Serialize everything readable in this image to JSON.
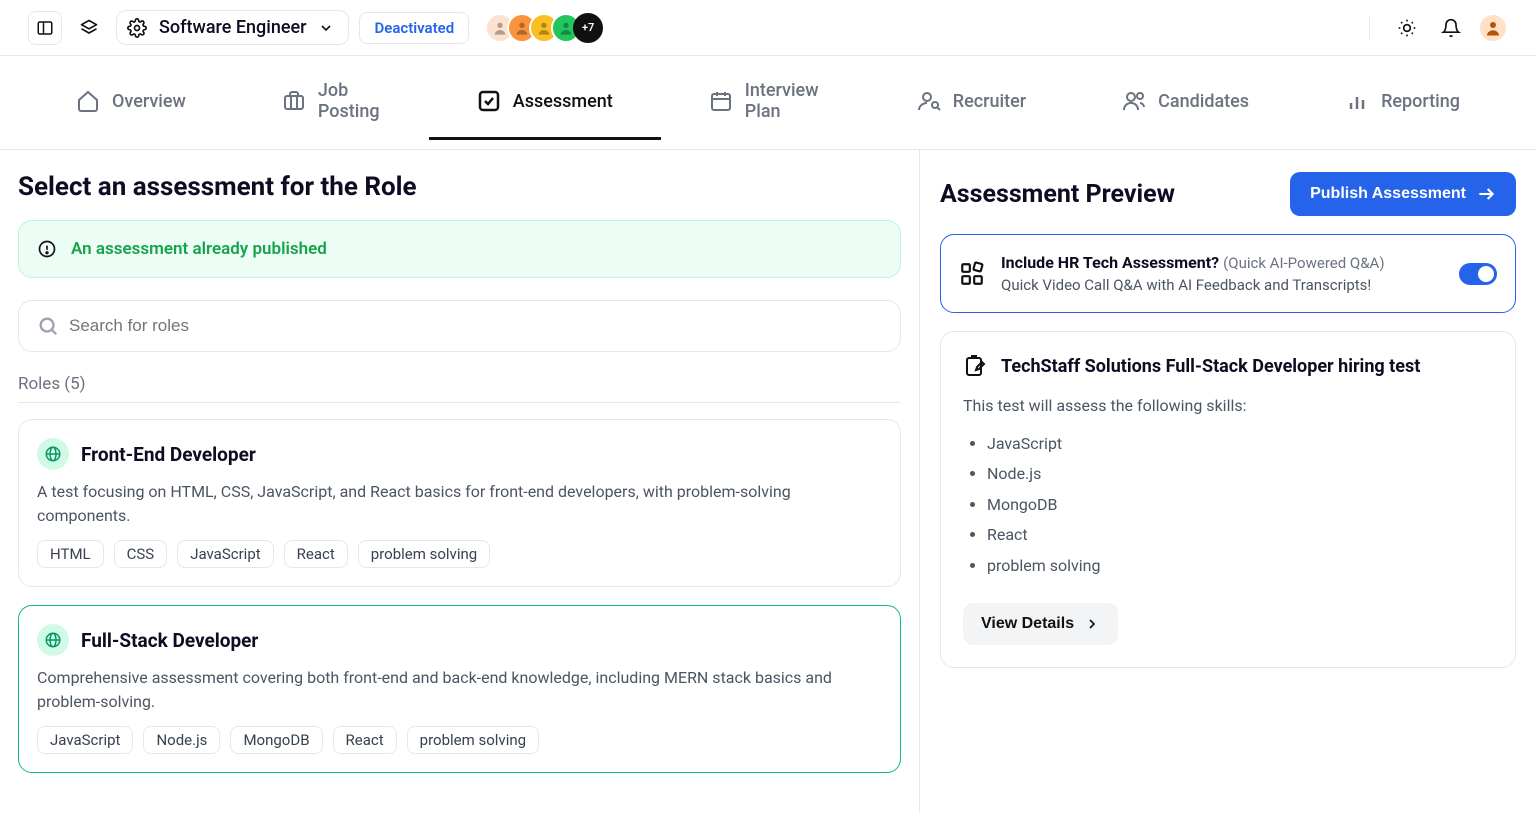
{
  "header": {
    "role_name": "Software Engineer",
    "status_chip": "Deactivated",
    "avatar_more": "+7",
    "avatar_colors": [
      "#fde2cf",
      "#fb923c",
      "#fbbf24",
      "#22c55e"
    ]
  },
  "tabs": [
    {
      "id": "overview",
      "label": "Overview"
    },
    {
      "id": "job-posting",
      "label": "Job Posting"
    },
    {
      "id": "assessment",
      "label": "Assessment",
      "active": true
    },
    {
      "id": "interview-plan",
      "label": "Interview Plan"
    },
    {
      "id": "recruiter",
      "label": "Recruiter"
    },
    {
      "id": "candidates",
      "label": "Candidates"
    },
    {
      "id": "reporting",
      "label": "Reporting"
    }
  ],
  "left": {
    "title": "Select an assessment for the Role",
    "alert": "An assessment already published",
    "search_placeholder": "Search for roles",
    "roles_label": "Roles (5)",
    "roles": [
      {
        "title": "Front-End Developer",
        "desc": "A test focusing on HTML, CSS, JavaScript, and React basics for front-end developers, with problem-solving components.",
        "tags": [
          "HTML",
          "CSS",
          "JavaScript",
          "React",
          "problem solving"
        ],
        "selected": false
      },
      {
        "title": "Full-Stack Developer",
        "desc": "Comprehensive assessment covering both front-end and back-end knowledge, including MERN stack basics and problem-solving.",
        "tags": [
          "JavaScript",
          "Node.js",
          "MongoDB",
          "React",
          "problem solving"
        ],
        "selected": true
      }
    ]
  },
  "right": {
    "preview_title": "Assessment Preview",
    "publish_label": "Publish Assessment",
    "hr_box": {
      "title": "Include HR Tech Assessment?",
      "hint": "(Quick AI-Powered Q&A)",
      "subtitle": "Quick Video Call Q&A with AI Feedback and Transcripts!"
    },
    "test": {
      "title": "TechStaff Solutions Full-Stack Developer hiring test",
      "intro": "This test will assess the following skills:",
      "skills": [
        "JavaScript",
        "Node.js",
        "MongoDB",
        "React",
        "problem solving"
      ],
      "view_details": "View Details"
    }
  }
}
